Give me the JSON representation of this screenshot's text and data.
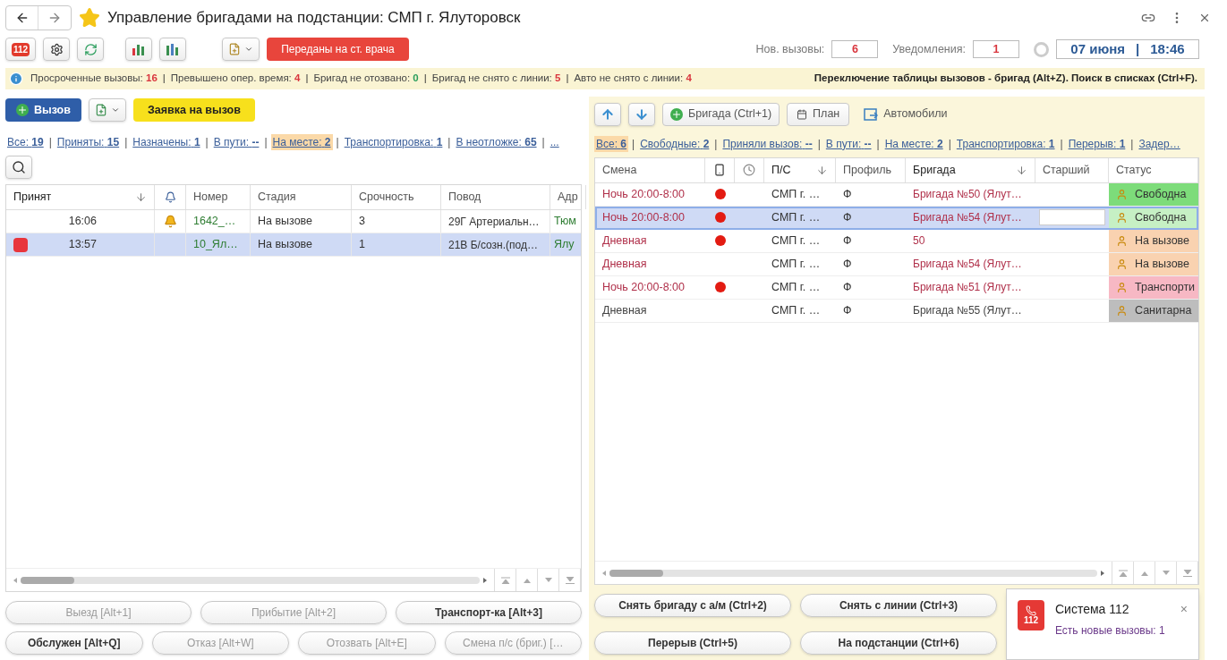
{
  "window": {
    "title": "Управление бригадами на подстанции: СМП г. Ялуторовск",
    "favorite": true
  },
  "toolbar": {
    "badge_112": "112",
    "transfer_button": "Переданы на ст. врача"
  },
  "counters": {
    "new_calls_label": "Нов. вызовы:",
    "new_calls": "6",
    "notifications_label": "Уведомления:",
    "notifications": "1",
    "date": "07 июня",
    "separator": "|",
    "time": "18:46"
  },
  "info_bar": {
    "items": [
      {
        "label": "Просроченные вызовы:",
        "value": "16",
        "color": "#d9363e"
      },
      {
        "separator": "|",
        "label": "Превышено опер. время:",
        "value": "4",
        "color": "#d9363e"
      },
      {
        "separator": "|",
        "label": "Бригад не отозвано:",
        "value": "0",
        "color": "#2a9d5c"
      },
      {
        "separator": "|",
        "label": "Бригад не снято с линии:",
        "value": "5",
        "color": "#d9363e"
      },
      {
        "separator": "|",
        "label": "Авто не снято с линии:",
        "value": "4",
        "color": "#d9363e"
      }
    ],
    "hint": "Переключение таблицы вызовов - бригад (Alt+Z). Поиск в списках (Ctrl+F)."
  },
  "calls": {
    "new_call_button": "Вызов",
    "request_button": "Заявка на вызов",
    "filters": [
      {
        "label": "Все:",
        "value": "19",
        "selected": false
      },
      {
        "separator": "|",
        "label": "Приняты:",
        "value": "15",
        "selected": false
      },
      {
        "separator": "|",
        "label": "Назначены:",
        "value": "1",
        "selected": false
      },
      {
        "separator": "|",
        "label": "В пути:",
        "value": "--",
        "selected": false
      },
      {
        "separator": "|",
        "label": "На месте:",
        "value": "2",
        "selected": true
      },
      {
        "separator": "|",
        "label": "Транспортировка:",
        "value": "1",
        "selected": false
      },
      {
        "separator": "|",
        "label": "В неотложке:",
        "value": "65",
        "selected": false
      },
      {
        "separator": "|",
        "label": "...",
        "selected": false
      }
    ],
    "columns": [
      {
        "label": "Принят",
        "sorted": true
      },
      {
        "label": "Номер",
        "sorted": false
      },
      {
        "label": "Стадия",
        "sorted": false
      },
      {
        "label": "Срочность",
        "sorted": false
      },
      {
        "label": "Повод",
        "sorted": false
      },
      {
        "label": "Адр",
        "sorted": false
      }
    ],
    "rows": [
      {
        "marker": false,
        "time": "16:06",
        "bell": true,
        "number": "1642_…",
        "stage": "На вызове",
        "urgency": "3",
        "reason": "29Г Артериальн…",
        "address": "Тюм",
        "selected": false
      },
      {
        "marker": true,
        "time": "13:57",
        "bell": false,
        "number": "10_Ял…",
        "stage": "На вызове",
        "urgency": "1",
        "reason": "21В Б/созн.(под…",
        "address": "Ялу",
        "selected": true
      }
    ],
    "buttons": [
      {
        "label": "Выезд [Alt+1]",
        "disabled": true
      },
      {
        "label": "Прибытие [Alt+2]",
        "disabled": true
      },
      {
        "label": "Транспорт-ка [Alt+3]",
        "disabled": false
      },
      {
        "label": "Обслужен [Alt+Q]",
        "disabled": false
      },
      {
        "label": "Отказ [Alt+W]",
        "disabled": true
      },
      {
        "label": "Отозвать [Alt+E]",
        "disabled": true
      },
      {
        "label": "Смена п/с (бриг.) […",
        "disabled": true
      }
    ]
  },
  "brigades": {
    "add_button": "Бригада (Ctrl+1)",
    "plan_button": "План",
    "cars_button": "Автомобили",
    "filters": [
      {
        "label": "Все:",
        "value": "6",
        "selected": true
      },
      {
        "separator": "|",
        "label": "Свободные:",
        "value": "2",
        "selected": false
      },
      {
        "separator": "|",
        "label": "Приняли вызов:",
        "value": "--",
        "selected": false
      },
      {
        "separator": "|",
        "label": "В пути:",
        "value": "--",
        "selected": false
      },
      {
        "separator": "|",
        "label": "На месте:",
        "value": "2",
        "selected": false
      },
      {
        "separator": "|",
        "label": "Транспортировка:",
        "value": "1",
        "selected": false
      },
      {
        "separator": "|",
        "label": "Перерыв:",
        "value": "1",
        "selected": false
      },
      {
        "separator": "|",
        "label": "Задер…",
        "selected": false
      }
    ],
    "columns": [
      {
        "label": "Смена",
        "sorted": false
      },
      {
        "label": "П/С",
        "sorted": true
      },
      {
        "label": "Профиль",
        "sorted": false
      },
      {
        "label": "Бригада",
        "sorted": true
      },
      {
        "label": "Старший",
        "sorted": false
      },
      {
        "label": "Статус",
        "sorted": false
      }
    ],
    "rows": [
      {
        "shift": "Ночь 20:00-8:00",
        "highlighted": true,
        "dot": true,
        "ps": "СМП г. …",
        "profile": "Ф",
        "brigade": "Бригада №50 (Ялут…",
        "senior_field": false,
        "status": {
          "label": "Свободна",
          "color": "#7ddc7a"
        },
        "selected": false
      },
      {
        "shift": "Ночь 20:00-8:00",
        "highlighted": true,
        "dot": true,
        "ps": "СМП г. …",
        "profile": "Ф",
        "brigade": "Бригада №54 (Ялут…",
        "senior_field": true,
        "status": {
          "label": "Свободна",
          "color": "#c6f0c4"
        },
        "selected": true
      },
      {
        "shift": "Дневная",
        "highlighted": true,
        "dot": true,
        "ps": "СМП г. …",
        "profile": "Ф",
        "brigade": "50",
        "senior_field": false,
        "status": {
          "label": "На вызове",
          "color": "#f9d2b0"
        },
        "selected": false
      },
      {
        "shift": "Дневная",
        "highlighted": true,
        "dot": false,
        "ps": "СМП г. …",
        "profile": "Ф",
        "brigade": "Бригада №54 (Ялут…",
        "senior_field": false,
        "status": {
          "label": "На вызове",
          "color": "#f9d2b0"
        },
        "selected": false
      },
      {
        "shift": "Ночь 20:00-8:00",
        "highlighted": true,
        "dot": true,
        "ps": "СМП г. …",
        "profile": "Ф",
        "brigade": "Бригада №51 (Ялут…",
        "senior_field": false,
        "status": {
          "label": "Транспорти",
          "color": "#f7b8c4"
        },
        "selected": false
      },
      {
        "shift": "Дневная",
        "highlighted": false,
        "dot": false,
        "ps": "СМП г. …",
        "profile": "Ф",
        "brigade": "Бригада №55 (Ялут…",
        "senior_field": false,
        "status": {
          "label": "Санитарна",
          "color": "#bdbdbd"
        },
        "selected": false
      }
    ],
    "buttons": [
      {
        "label": "Снять бригаду с а/м (Ctrl+2)",
        "disabled": false
      },
      {
        "label": "Снять с линии (Ctrl+3)",
        "disabled": false
      },
      {
        "label": "Перерыв (Ctrl+5)",
        "disabled": false
      },
      {
        "label": "На подстанции (Ctrl+6)",
        "disabled": false
      }
    ]
  },
  "notification": {
    "badge": "112",
    "title": "Система 112",
    "message": "Есть новые вызовы: 1",
    "close": "×"
  }
}
